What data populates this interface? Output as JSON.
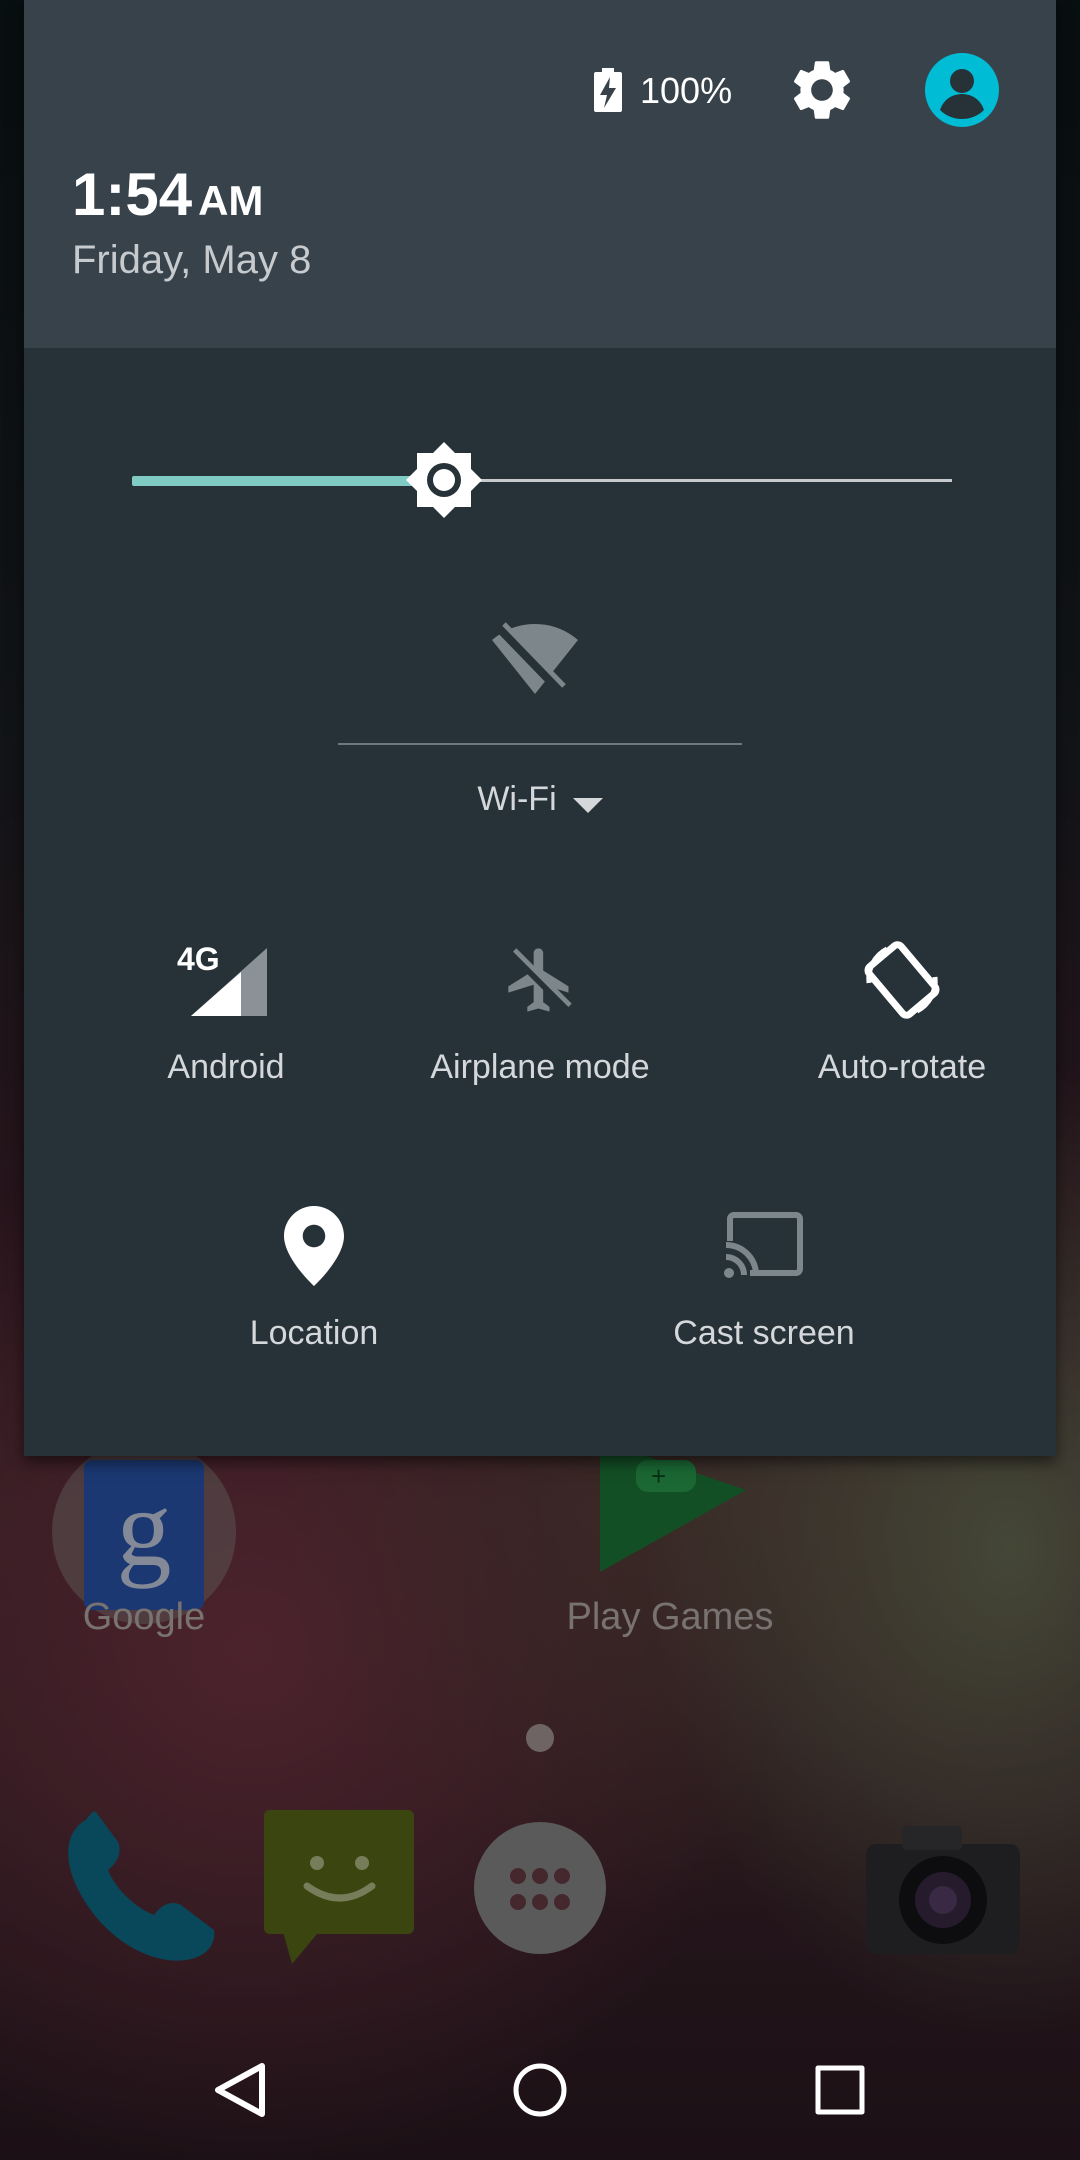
{
  "status": {
    "battery_percent": "100%",
    "time": "1:54",
    "ampm": "AM",
    "date": "Friday, May 8"
  },
  "brightness": {
    "level": 0.38
  },
  "tiles": {
    "wifi": {
      "label": "Wi-Fi",
      "icon": "wifi-off-icon"
    },
    "cellular": {
      "label": "Android",
      "badge": "4G",
      "icon": "signal-4g-icon"
    },
    "airplane": {
      "label": "Airplane mode",
      "icon": "airplane-icon"
    },
    "rotate": {
      "label": "Auto-rotate",
      "icon": "rotate-icon"
    },
    "location": {
      "label": "Location",
      "icon": "location-pin-icon"
    },
    "cast": {
      "label": "Cast screen",
      "icon": "cast-icon"
    }
  },
  "home": {
    "apps": [
      {
        "label": "Google"
      },
      {
        "label": "Play Games"
      }
    ]
  },
  "colors": {
    "shade_bg": "#263238",
    "header_bg": "#37424b",
    "accent": "#80cbc4",
    "avatar": "#00bcd4"
  }
}
